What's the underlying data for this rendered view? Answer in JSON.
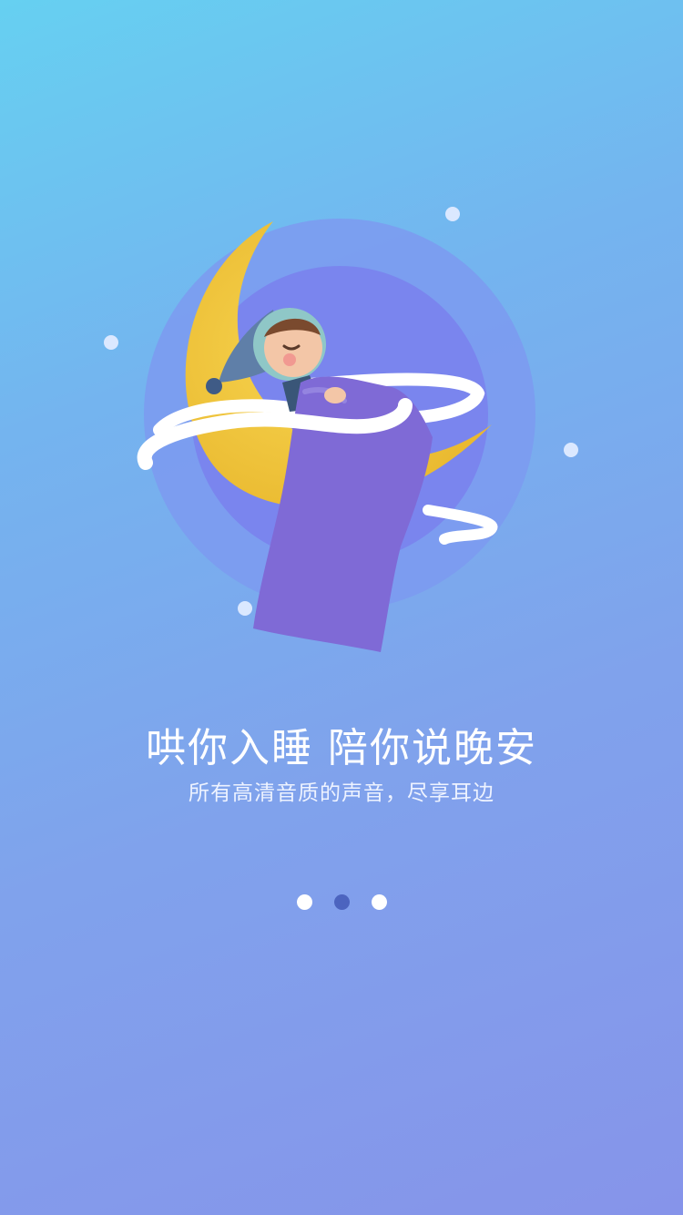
{
  "onboarding": {
    "headline": "哄你入睡 陪你说晚安",
    "subline": "所有高清音质的声音，尽享耳边"
  },
  "pager": {
    "total": 3,
    "active_index": 1
  },
  "illustration": {
    "icon": "sleeping-child-on-moon-illustration"
  },
  "colors": {
    "background_top": "#66d0f1",
    "background_bottom": "#8694ea",
    "moon": "#f4c83a",
    "blanket": "#7f6ad6",
    "pager_active": "#4c64bf",
    "pager_inactive": "#ffffff"
  }
}
